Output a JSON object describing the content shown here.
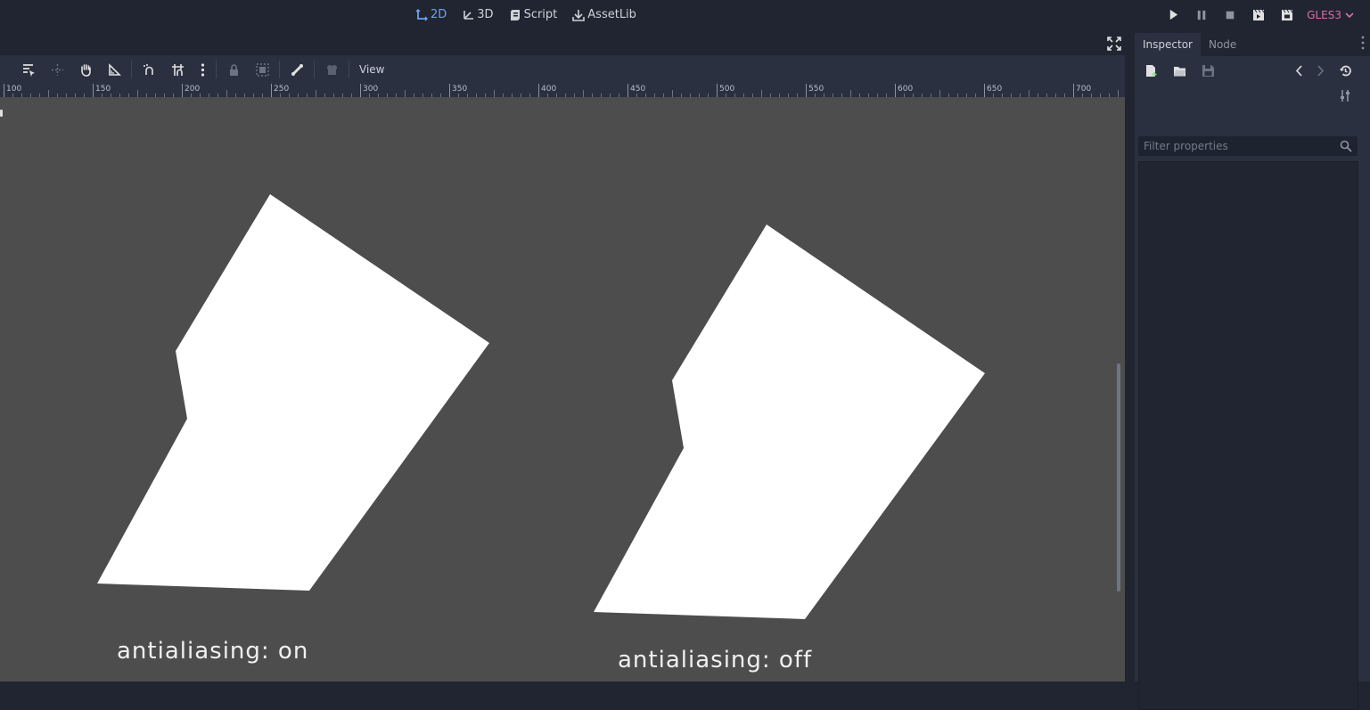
{
  "workspace_tabs": [
    {
      "label": "2D",
      "icon": "2d-icon",
      "active": true
    },
    {
      "label": "3D",
      "icon": "3d-icon",
      "active": false
    },
    {
      "label": "Script",
      "icon": "script-icon",
      "active": false
    },
    {
      "label": "AssetLib",
      "icon": "assetlib-icon",
      "active": false
    }
  ],
  "renderer": "GLES3",
  "toolbar": {
    "view_label": "View"
  },
  "ruler": {
    "labels": [
      "100",
      "150",
      "200",
      "250",
      "300",
      "350",
      "400",
      "450",
      "500",
      "550",
      "600",
      "650",
      "700"
    ]
  },
  "canvas": {
    "background": "#4d4d4d",
    "captions": {
      "left": "antialiasing: on",
      "right": "antialiasing: off"
    }
  },
  "dock": {
    "tabs": [
      {
        "label": "Inspector",
        "active": true
      },
      {
        "label": "Node",
        "active": false
      }
    ],
    "filter_placeholder": "Filter properties"
  },
  "colors": {
    "accent": "#6fa0f2",
    "renderer": "#d96dac",
    "editor_bg": "#202531",
    "panel_bg": "#2a3040"
  }
}
